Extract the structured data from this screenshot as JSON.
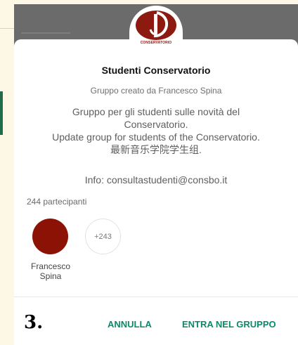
{
  "logo": {
    "text": "CONSERVATORIO"
  },
  "group": {
    "title": "Studenti Conservatorio",
    "created_by": "Gruppo creato da Francesco Spina",
    "description": [
      "Gruppo per gli studenti sulle novità del",
      "Conservatorio.",
      "Update group for students of the Conservatorio.",
      "最新音乐学院学生组."
    ],
    "info": "Info: consultastudenti@consbo.it",
    "participants_count": "244 partecipanti",
    "more_participants": "+243",
    "member": {
      "name_line1": "Francesco",
      "name_line2": "Spina",
      "avatar_color": "#8c1205"
    }
  },
  "annotation": {
    "step": "3."
  },
  "actions": {
    "cancel": "ANNULLA",
    "join": "ENTRA NEL GRUPPO"
  },
  "colors": {
    "accent": "#0b8a6a",
    "brand": "#8c1205"
  }
}
